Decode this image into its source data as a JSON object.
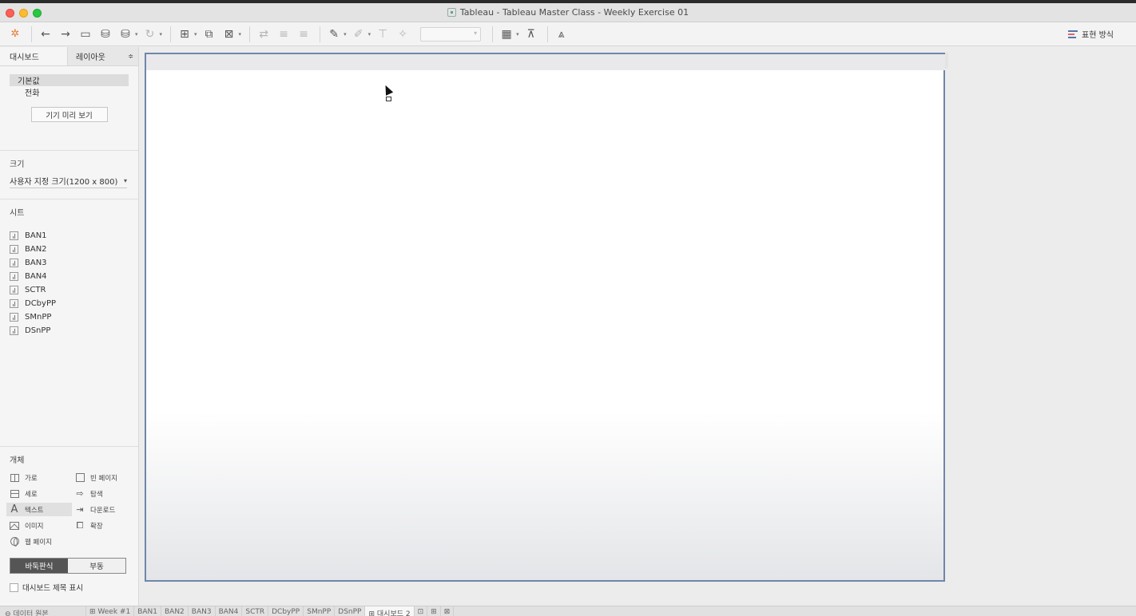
{
  "window": {
    "title": "Tableau - Tableau Master Class - Weekly Exercise 01"
  },
  "toolbar": {
    "show_me_label": "표현 방식"
  },
  "left_panel": {
    "tabs": [
      {
        "label": "대시보드",
        "active": true
      },
      {
        "label": "레이아웃",
        "active": false
      }
    ],
    "device": {
      "items": [
        "기본값",
        "전화"
      ],
      "selected": "기본값",
      "preview_button": "기기 미리 보기"
    },
    "size": {
      "label": "크기",
      "value": "사용자 지정 크기(1200 x 800)"
    },
    "sheets": {
      "label": "시트",
      "items": [
        "BAN1",
        "BAN2",
        "BAN3",
        "BAN4",
        "SCTR",
        "DCbyPP",
        "SMnPP",
        "DSnPP"
      ]
    },
    "objects": {
      "label": "개체",
      "items": [
        {
          "label": "가로",
          "icon": "horizontal-container-icon"
        },
        {
          "label": "빈 페이지",
          "icon": "blank-icon"
        },
        {
          "label": "세로",
          "icon": "vertical-container-icon"
        },
        {
          "label": "탐색",
          "icon": "navigation-icon"
        },
        {
          "label": "텍스트",
          "icon": "text-icon"
        },
        {
          "label": "다운로드",
          "icon": "download-icon"
        },
        {
          "label": "이미지",
          "icon": "image-icon"
        },
        {
          "label": "확장",
          "icon": "extension-icon"
        },
        {
          "label": "웹 페이지",
          "icon": "web-page-icon"
        }
      ],
      "layout_options": [
        "바둑판식",
        "부동"
      ],
      "layout_selected": "바둑판식",
      "show_title_label": "대시보드 제목 표시"
    }
  },
  "bottom_tabs": [
    {
      "label": "⊖ 데이터 원본"
    },
    {
      "label": "⊞ Week #1"
    },
    {
      "label": "BAN1"
    },
    {
      "label": "BAN2"
    },
    {
      "label": "BAN3"
    },
    {
      "label": "BAN4"
    },
    {
      "label": "SCTR"
    },
    {
      "label": "DCbyPP"
    },
    {
      "label": "SMnPP"
    },
    {
      "label": "DSnPP"
    },
    {
      "label": "⊞ 대시보드 2",
      "active": true
    },
    {
      "label": "⊡"
    },
    {
      "label": "⊞"
    },
    {
      "label": "⊠"
    }
  ]
}
